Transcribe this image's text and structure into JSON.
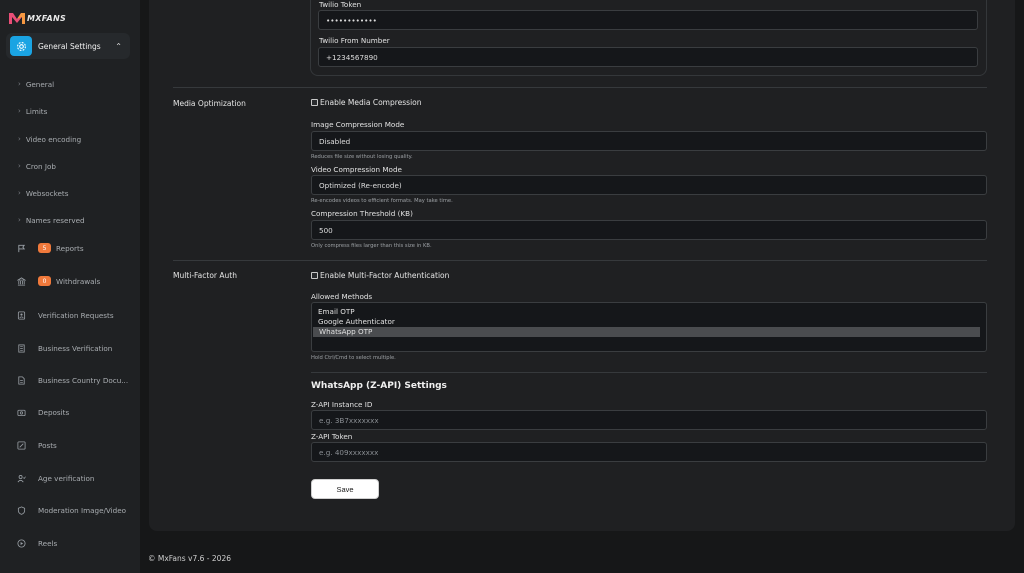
{
  "brand": {
    "logo_text": "MXFANS",
    "logo_colors": [
      "#e94e77",
      "#f7a13b",
      "#7c5cff"
    ]
  },
  "sidebar": {
    "section": {
      "label": "General Settings",
      "icon": "gear-icon",
      "accent": "#1aa4e3"
    },
    "sub_items": [
      {
        "label": "General"
      },
      {
        "label": "Limits"
      },
      {
        "label": "Video encoding"
      },
      {
        "label": "Cron Job"
      },
      {
        "label": "Websockets"
      },
      {
        "label": "Names reserved"
      }
    ],
    "nav_items": [
      {
        "label": "Reports",
        "icon": "flag-icon",
        "badge": "5"
      },
      {
        "label": "Withdrawals",
        "icon": "bank-icon",
        "badge": "0"
      },
      {
        "label": "Verification Requests",
        "icon": "id-card-icon"
      },
      {
        "label": "Business Verification",
        "icon": "building-icon"
      },
      {
        "label": "Business Country Docu...",
        "icon": "document-icon"
      },
      {
        "label": "Deposits",
        "icon": "deposit-icon"
      },
      {
        "label": "Posts",
        "icon": "edit-icon"
      },
      {
        "label": "Age verification",
        "icon": "user-check-icon"
      },
      {
        "label": "Moderation Image/Video",
        "icon": "shield-icon"
      },
      {
        "label": "Reels",
        "icon": "play-circle-icon"
      }
    ]
  },
  "twilio": {
    "token_label": "Twilio Token",
    "token_value": "••••••••••••",
    "from_label": "Twilio From Number",
    "from_value": "+1234567890"
  },
  "media": {
    "section_label": "Media Optimization",
    "enable_label": "Enable Media Compression",
    "image_mode_label": "Image Compression Mode",
    "image_mode_value": "Disabled",
    "image_hint": "Reduces file size without losing quality.",
    "video_mode_label": "Video Compression Mode",
    "video_mode_value": "Optimized (Re-encode)",
    "video_hint": "Re-encodes videos to efficient formats. May take time.",
    "threshold_label": "Compression Threshold (KB)",
    "threshold_value": "500",
    "threshold_hint": "Only compress files larger than this size in KB."
  },
  "mfa": {
    "section_label": "Multi-Factor Auth",
    "enable_label": "Enable Multi-Factor Authentication",
    "methods_label": "Allowed Methods",
    "methods": [
      {
        "label": "Email OTP",
        "selected": false
      },
      {
        "label": "Google Authenticator",
        "selected": false
      },
      {
        "label": "WhatsApp OTP",
        "selected": true
      }
    ],
    "methods_hint": "Hold Ctrl/Cmd to select multiple."
  },
  "zapi": {
    "heading": "WhatsApp (Z-API) Settings",
    "instance_label": "Z-API Instance ID",
    "instance_placeholder": "e.g. 3B7xxxxxxx",
    "token_label": "Z-API Token",
    "token_placeholder": "e.g. 409xxxxxxx"
  },
  "actions": {
    "save_label": "Save"
  },
  "footer": {
    "text": "© MxFans v7.6 - 2026"
  }
}
